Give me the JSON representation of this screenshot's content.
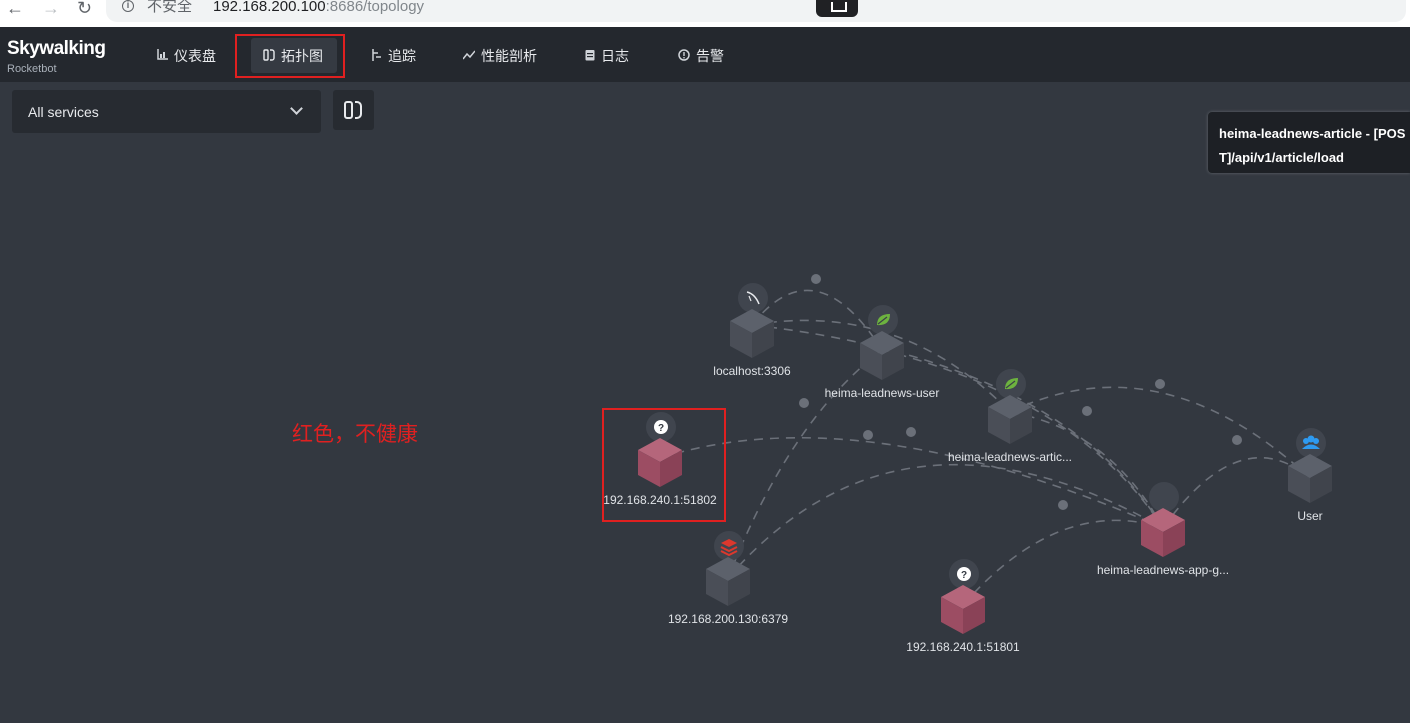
{
  "browser": {
    "security_label": "不安全",
    "url_host": "192.168.200.100",
    "url_rest": ":8686/topology"
  },
  "app": {
    "logo_title": "Skywalking",
    "logo_subtitle": "Rocketbot"
  },
  "nav": {
    "items": [
      {
        "label": "仪表盘",
        "icon": "chart-icon"
      },
      {
        "label": "拓扑图",
        "icon": "topology-icon",
        "active": true
      },
      {
        "label": "追踪",
        "icon": "trace-icon"
      },
      {
        "label": "性能剖析",
        "icon": "profile-icon"
      },
      {
        "label": "日志",
        "icon": "log-icon"
      },
      {
        "label": "告警",
        "icon": "alarm-icon"
      }
    ]
  },
  "controls": {
    "service_select": "All services"
  },
  "tooltip": {
    "line1": "heima-leadnews-article - [POS",
    "line2": "T]/api/v1/article/load"
  },
  "annotation": "红色，不健康",
  "topology": {
    "nodes": [
      {
        "id": "mysql",
        "label": "localhost:3306",
        "health": "normal",
        "icon": "mysql-icon"
      },
      {
        "id": "user",
        "label": "heima-leadnews-user",
        "health": "normal",
        "icon": "spring-icon"
      },
      {
        "id": "article",
        "label": "heima-leadnews-artic...",
        "health": "normal",
        "icon": "spring-icon"
      },
      {
        "id": "unknown1",
        "label": "192.168.240.1:51802",
        "health": "unhealthy",
        "icon": "question-icon"
      },
      {
        "id": "redis",
        "label": "192.168.200.130:6379",
        "health": "normal",
        "icon": "redis-icon"
      },
      {
        "id": "unknown2",
        "label": "192.168.240.1:51801",
        "health": "unhealthy",
        "icon": "question-icon"
      },
      {
        "id": "gateway",
        "label": "heima-leadnews-app-g...",
        "health": "unhealthy",
        "icon": "gateway-icon"
      },
      {
        "id": "client",
        "label": "User",
        "health": "normal",
        "icon": "users-icon"
      }
    ],
    "colors": {
      "normal_top": "#5c616b",
      "normal_left": "#4a4e57",
      "normal_right": "#40444c",
      "unhealthy_top": "#b5667b",
      "unhealthy_left": "#9c4d63",
      "unhealthy_right": "#8a4257",
      "link": "#6b7079",
      "annotation": "#e02020"
    }
  }
}
